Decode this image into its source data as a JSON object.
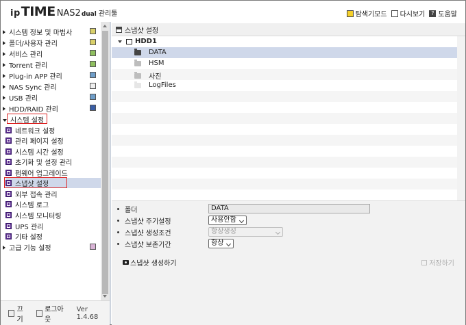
{
  "header": {
    "logo_ip": "ip",
    "logo_time": "TIME",
    "logo_model": "NAS2",
    "logo_variant": "dual",
    "logo_manager": "관리툴",
    "links": [
      {
        "label": "탐색기모드",
        "icon": "explorer-icon"
      },
      {
        "label": "다시보기",
        "icon": "reload-icon"
      },
      {
        "label": "도움말",
        "icon": "help-icon"
      }
    ]
  },
  "sidebar": {
    "items": [
      {
        "label": "시스템 정보 및 마법사"
      },
      {
        "label": "폴더/사용자 관리"
      },
      {
        "label": "서비스 관리"
      },
      {
        "label": "Torrent 관리"
      },
      {
        "label": "Plug-in APP 관리"
      },
      {
        "label": "NAS Sync 관리"
      },
      {
        "label": "USB 관리"
      },
      {
        "label": "HDD/RAID 관리"
      },
      {
        "label": "시스템 설정"
      }
    ],
    "sub_items": [
      {
        "label": "네트워크 설정"
      },
      {
        "label": "관리 페이지 설정"
      },
      {
        "label": "시스템 시간 설정"
      },
      {
        "label": "초기화 및 설정 관리"
      },
      {
        "label": "펌웨어 업그레이드"
      },
      {
        "label": "스냅샷 설정"
      },
      {
        "label": "외부 접속 관리"
      },
      {
        "label": "시스템 로그"
      },
      {
        "label": "시스템 모니터링"
      },
      {
        "label": "UPS 관리"
      },
      {
        "label": "기타 설정"
      }
    ],
    "advanced": {
      "label": "고급 기능 설정"
    }
  },
  "footer": {
    "close_label": "끄기",
    "logout_label": "로그아웃",
    "version": "Ver 1.4.68"
  },
  "main": {
    "title": "스냅샷 설정",
    "tree": {
      "drive": "HDD1",
      "folders": [
        {
          "label": "DATA"
        },
        {
          "label": "HSM"
        },
        {
          "label": "사진"
        },
        {
          "label": "LogFiles"
        }
      ]
    },
    "form": {
      "folder_label": "폴더",
      "folder_value": "DATA",
      "period_label": "스냅샷 주기설정",
      "period_value": "사용안함",
      "condition_label": "스냅샷 생성조건",
      "condition_value": "항상생성",
      "retention_label": "스냅샷 보존기간",
      "retention_value": "항상",
      "create_label": "스냅샷 생성하기",
      "save_label": "저장하기"
    }
  }
}
